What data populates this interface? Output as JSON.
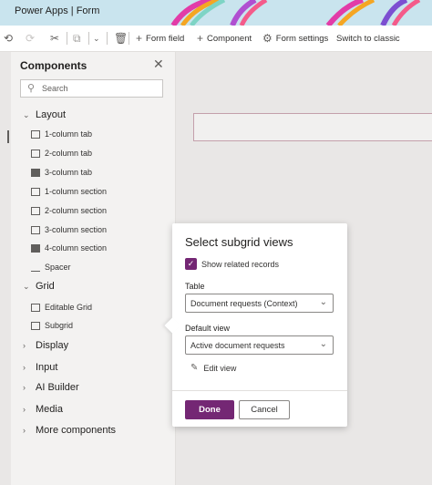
{
  "title_bar": {
    "app_name": "Power Apps",
    "separator": "|",
    "page": "Form"
  },
  "command_bar": {
    "undo_icon": "undo-icon",
    "redo_icon": "redo-icon",
    "cut_icon": "cut-icon",
    "copy_icon": "copy-icon",
    "more_icon": "chevron-down-icon",
    "delete_icon": "delete-icon",
    "form_field": "Form field",
    "component": "Component",
    "form_settings": "Form settings",
    "switch_to_classic": "Switch to classic"
  },
  "components_panel": {
    "title": "Components",
    "search_placeholder": "Search",
    "groups": [
      {
        "label": "Layout",
        "expanded": true,
        "items": [
          "1-column tab",
          "2-column tab",
          "3-column tab",
          "1-column section",
          "2-column section",
          "3-column section",
          "4-column section",
          "Spacer"
        ]
      },
      {
        "label": "Grid",
        "expanded": true,
        "items": [
          "Editable Grid",
          "Subgrid"
        ]
      },
      {
        "label": "Display",
        "expanded": false
      },
      {
        "label": "Input",
        "expanded": false
      },
      {
        "label": "AI Builder",
        "expanded": false
      },
      {
        "label": "Media",
        "expanded": false
      },
      {
        "label": "More components",
        "expanded": false
      }
    ]
  },
  "subgrid_popup": {
    "title": "Select subgrid views",
    "show_related_records": {
      "label": "Show related records",
      "checked": true
    },
    "table": {
      "label": "Table",
      "value": "Document requests (Context)"
    },
    "default_view": {
      "label": "Default view",
      "value": "Active document requests"
    },
    "edit_view": "Edit view",
    "done": "Done",
    "cancel": "Cancel"
  },
  "colors": {
    "accent": "#742774",
    "panel_bg": "#f3f2f1",
    "canvas_bg": "#e9e7e6"
  }
}
